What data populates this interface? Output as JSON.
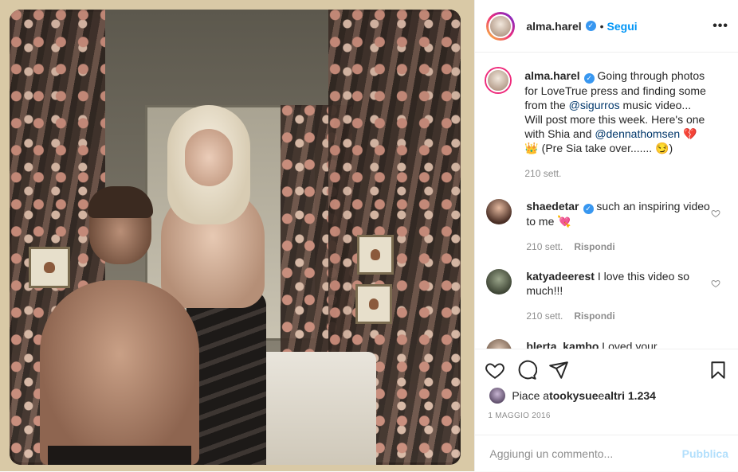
{
  "header": {
    "username": "alma.harel",
    "follow_label": "Segui",
    "separator": "•",
    "more_label": "•••"
  },
  "caption": {
    "username": "alma.harel",
    "text_1": "Going through photos for LoveTrue press and finding some from the ",
    "mention_1": "@sigurros",
    "text_2": " music video... Will post more this week. Here's one with Shia and ",
    "mention_2": "@dennathomsen",
    "text_3": " 💔👑 (Pre Sia take over....... 😏)",
    "time": "210 sett."
  },
  "comments": [
    {
      "username": "shaedetar",
      "verified": true,
      "text": "such an inspiring video to me 💘",
      "time": "210 sett.",
      "reply_label": "Rispondi"
    },
    {
      "username": "katyadeerest",
      "verified": false,
      "text": "I love this video so much!!!",
      "time": "210 sett.",
      "reply_label": "Rispondi"
    },
    {
      "username": "blerta_kambo",
      "verified": false,
      "text": "Loved your"
    }
  ],
  "likes": {
    "prefix": "Piace a ",
    "user": "tookysue",
    "middle": " e ",
    "others": "altri 1.234"
  },
  "date": "1 MAGGIO 2016",
  "add_comment": {
    "placeholder": "Aggiungi un commento...",
    "publish_label": "Pubblica"
  },
  "colors": {
    "accent": "#0095f6",
    "verified": "#3897f0",
    "publish_disabled": "#b2dffc"
  }
}
